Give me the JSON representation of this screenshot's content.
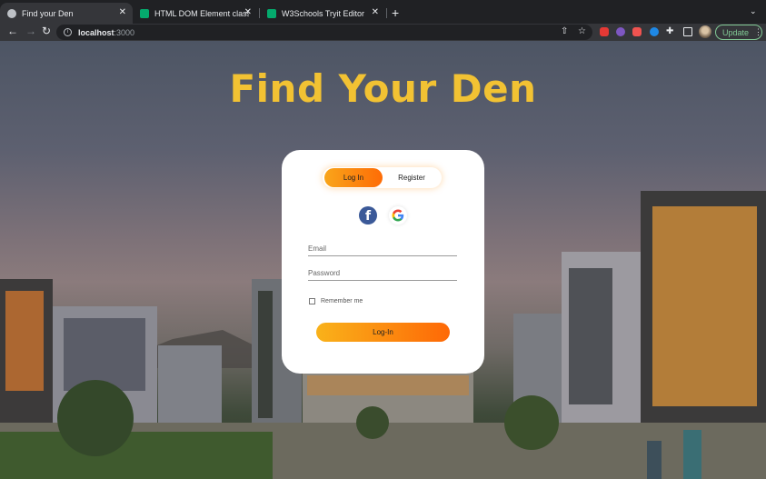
{
  "tabs": [
    {
      "title": "Find your Den",
      "favicon": "globe-icon",
      "active": true
    },
    {
      "title": "HTML DOM Element classList",
      "favicon": "w3schools-icon",
      "active": false
    },
    {
      "title": "W3Schools Tryit Editor",
      "favicon": "w3schools-icon",
      "active": false
    }
  ],
  "address_bar": {
    "host": "localhost",
    "port": ":3000"
  },
  "toolbar": {
    "update_label": "Update"
  },
  "page": {
    "title": "Find Your Den",
    "tabs": {
      "login": "Log In",
      "register": "Register"
    },
    "form": {
      "email_placeholder": "Email",
      "password_placeholder": "Password",
      "remember_label": "Remember me",
      "submit_label": "Log-In"
    },
    "social": [
      "facebook-icon",
      "google-icon"
    ]
  },
  "colors": {
    "title": "#f2c233",
    "accent_start": "#f9a51a",
    "accent_end": "#fe6c06",
    "facebook": "#3b5998"
  }
}
